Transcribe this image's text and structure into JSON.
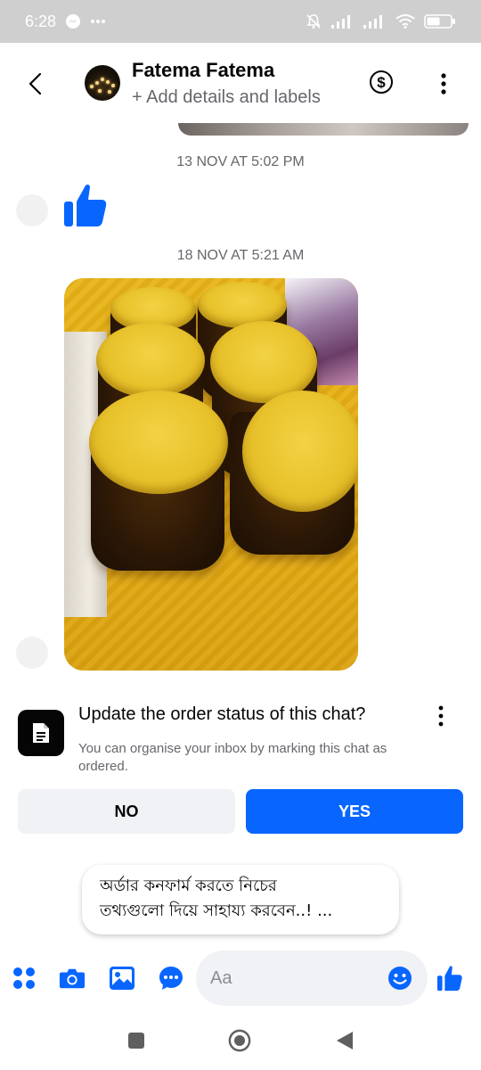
{
  "status_bar": {
    "time": "6:28",
    "battery": "49",
    "icons": [
      "messenger-icon",
      "more-dots-icon",
      "mute-icon",
      "signal-icon",
      "signal-icon",
      "wifi-icon",
      "battery-icon"
    ]
  },
  "header": {
    "contact_name": "Fatema Fatema",
    "subtitle": "+ Add details and labels",
    "icons": [
      "back-arrow-icon",
      "avatar",
      "dollar-icon",
      "more-vertical-icon"
    ]
  },
  "messages": [
    {
      "type": "timestamp",
      "text": "13 NOV AT 5:02 PM"
    },
    {
      "type": "like",
      "icon": "thumbs-up-icon"
    },
    {
      "type": "timestamp",
      "text": "18 NOV AT 5:21 AM"
    },
    {
      "type": "photo",
      "subject": "jars-with-yellow-lids"
    }
  ],
  "order_prompt": {
    "title": "Update the order status of this chat?",
    "description": "You can organise your inbox by marking this chat as ordered.",
    "no_label": "NO",
    "yes_label": "YES",
    "icon": "document-icon"
  },
  "suggestion": {
    "line1": "অর্ডার কনফার্ম করতে নিচের",
    "line2": "তথ্যগুলো দিয়ে সাহায্য করবেন..! ..."
  },
  "composer": {
    "placeholder": "Aa",
    "icons": [
      "menu-grid-icon",
      "camera-icon",
      "gallery-icon",
      "chat-bubble-icon",
      "emoji-icon",
      "thumbs-up-icon"
    ]
  },
  "colors": {
    "accent": "#0866ff",
    "status_bar_bg": "#cfcfcf",
    "secondary_text": "#65676b"
  }
}
